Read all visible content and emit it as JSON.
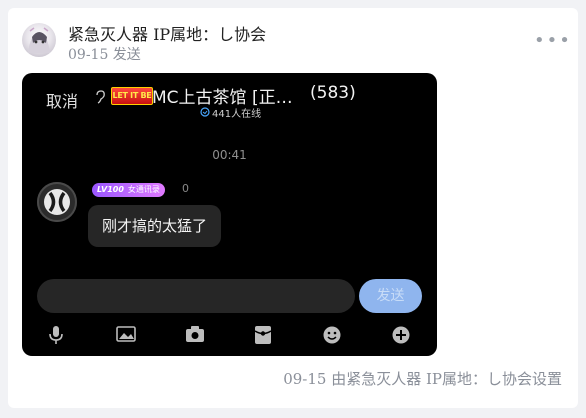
{
  "post": {
    "author": "紧急灭人器 IP属地：し协会",
    "date": "09-15 发送",
    "more_label": "•••",
    "footer": "09-15 由紧急灭人器 IP属地：し协会设置"
  },
  "screenshot": {
    "cancel_label": "取消",
    "badge_text": "LET IT BE",
    "group_name": "MC上古茶馆 [正…",
    "member_count": "(583)",
    "online": "441人在线",
    "time": "00:41",
    "sender": {
      "level": "LV100",
      "title": "女通讯录",
      "tail": "0"
    },
    "message": "刚才搞的太猛了",
    "send_label": "发送",
    "toolbar_icons": [
      "microphone-icon",
      "image-icon",
      "camera-icon",
      "red-packet-icon",
      "emoji-icon",
      "plus-icon"
    ]
  },
  "colors": {
    "background": "#f1f2f5",
    "card": "#ffffff",
    "screenshot_bg": "#000000",
    "send_button": "#8fb5ee",
    "level_badge": "#b266ff"
  }
}
